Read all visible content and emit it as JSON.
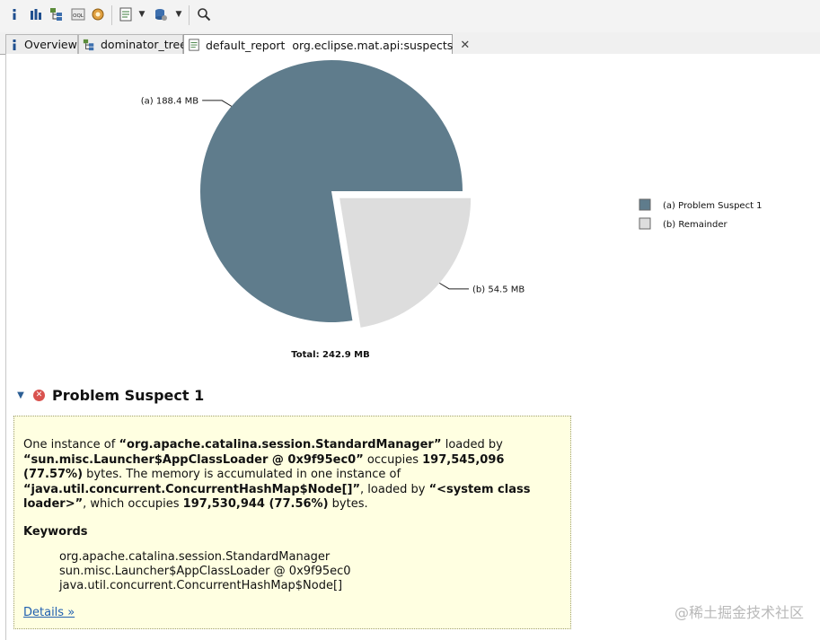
{
  "tabs": [
    {
      "label": "Overview",
      "icon": "info-icon"
    },
    {
      "label": "dominator_tree",
      "icon": "tree-icon"
    },
    {
      "label": "default_report  org.eclipse.mat.api:suspects",
      "icon": "report-icon",
      "active": true
    }
  ],
  "toolbar": {
    "icons": [
      "info-icon",
      "histogram-icon",
      "dominator-tree-icon",
      "oql-icon",
      "thread-overview-icon",
      "run-report-icon",
      "query-browser-icon",
      "search-icon"
    ]
  },
  "chart_data": {
    "type": "pie",
    "slices": [
      {
        "label": "(a)  188.4 MB",
        "legend": "(a)  Problem Suspect 1",
        "value": 188.4,
        "color": "#5f7c8c"
      },
      {
        "label": "(b)  54.5 MB",
        "legend": "(b)  Remainder",
        "value": 54.5,
        "color": "#dddddd"
      }
    ],
    "total": "Total: 242.9 MB",
    "legend_position": "right"
  },
  "suspect": {
    "title": "Problem Suspect 1",
    "p1_t1": "One instance of ",
    "p1_b1": "“org.apache.catalina.session.StandardManager”",
    "p1_t2": " loaded by ",
    "p1_b2": "“sun.misc.Launcher$AppClassLoader @ 0x9f95ec0”",
    "p1_t3": " occupies ",
    "p1_b3": "197,545,096 (77.57%)",
    "p1_t4": " bytes. The memory is accumulated in one instance of ",
    "p1_b4": "“java.util.concurrent.ConcurrentHashMap$Node[]”",
    "p1_t5": ", loaded by ",
    "p1_b5": "“<system class loader>”",
    "p1_t6": ", which occupies ",
    "p1_b6": "197,530,944 (77.56%)",
    "p1_t7": " bytes.",
    "keywords_title": "Keywords",
    "keywords": [
      "org.apache.catalina.session.StandardManager",
      "sun.misc.Launcher$AppClassLoader @ 0x9f95ec0",
      "java.util.concurrent.ConcurrentHashMap$Node[]"
    ],
    "details_link": "Details »"
  },
  "watermark": "@稀土掘金技术社区"
}
